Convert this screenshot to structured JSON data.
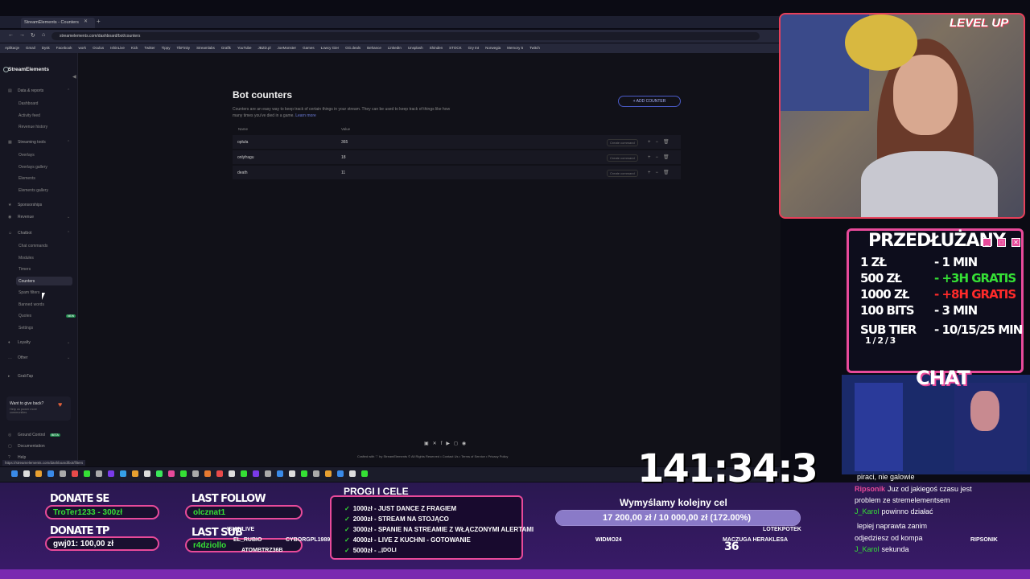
{
  "browser": {
    "tab_title": "StreamElements - Counters",
    "url": "streamelements.com/dashboard/bot/counters",
    "bookmarks": [
      "Aplikacje",
      "Gmail",
      "Dysk",
      "Facebook",
      "work",
      "Oculus",
      "IshinLive",
      "Kick",
      "Twitter",
      "Tippy",
      "TikFinity",
      "Streamlabs",
      "Grafik",
      "YouTube",
      "JBZD.pl",
      "JoeMonster",
      "Games",
      "Łowcy Gier",
      "GG.deals",
      "Behance",
      "LinkedIn",
      "Unsplash",
      "Shinden",
      "STOCK",
      "Gry tnt",
      "Norwegia",
      "Memory 5",
      "Twitch"
    ]
  },
  "sidebar": {
    "brand": "StreamElements",
    "sections": [
      {
        "label": "Data & reports",
        "items": [
          "Dashboard",
          "Activity feed",
          "Revenue history"
        ]
      },
      {
        "label": "Streaming tools",
        "items": [
          "Overlays",
          "Overlays gallery",
          "Elements",
          "Elements gallery"
        ]
      },
      {
        "label": "Sponsorships"
      },
      {
        "label": "Revenue"
      },
      {
        "label": "Chatbot",
        "items": [
          "Chat commands",
          "Modules",
          "Timers",
          "Counters",
          "Spam filters",
          "Banned words",
          "Quotes",
          "Settings"
        ]
      },
      {
        "label": "Loyalty"
      },
      {
        "label": "Other"
      },
      {
        "label": "GrabTap"
      }
    ],
    "new_badge": "NEW",
    "giveback_title": "Want to give back?",
    "giveback_text": "Help us power more communities",
    "bottom_links": [
      "Ground Control",
      "Documentation",
      "Help"
    ],
    "beta_badge": "BETA"
  },
  "main": {
    "title": "Bot counters",
    "description": "Counters are an easy way to keep track of certain things in your stream. They can be used to keep track of things like how many times you've died in a game.",
    "learn_more": "Learn more",
    "add_button": "+ ADD COUNTER",
    "columns": [
      "Name",
      "Value"
    ],
    "counters": [
      {
        "name": "opłuła",
        "value": "365"
      },
      {
        "name": "onlyfragu",
        "value": "18"
      },
      {
        "name": "death",
        "value": "11"
      }
    ],
    "create_command": "Create command",
    "footer": "Crafted with ♡ by StreamElements © All Rights Reserved • Contact Us • Terms of Service • Privacy Policy",
    "status_url": "https://streamelements.com/dashboard/bot/filters"
  },
  "overlay": {
    "logo": "LEVEL UP",
    "panel_title": "PRZEDŁUŻANY",
    "rates": [
      {
        "left": "1 ZŁ",
        "right": "- 1 MIN"
      },
      {
        "left": "500 ZŁ",
        "right": "- +3H GRATIS"
      },
      {
        "left": "1000 ZŁ",
        "right": "- +8H GRATIS"
      },
      {
        "left": "100 BITS",
        "right": "- 3 MIN"
      },
      {
        "left": "SUB TIER",
        "right": "- 10/15/25 MIN"
      }
    ],
    "sub_tiers": "1 / 2 / 3",
    "chat_title": "CHAT",
    "timer": "141:34:3",
    "donate_se_label": "DONATE SE",
    "donate_se_value": "TroTer1233 - 300zł",
    "donate_tp_label": "DONATE TP",
    "donate_tp_value": "gwj01: 100,00 zł",
    "last_follow_label": "LAST FOLLOW",
    "last_follow_value": "olcznat1",
    "last_sub_label": "LAST SUB",
    "last_sub_value": "r4dziollo",
    "goals_title": "PROGI I CELE",
    "goals": [
      "1000zł - JUST DANCE Z FRAGIEM",
      "2000zł - STREAM NA STOJĄCO",
      "3000zł - SPANIE NA STREAMIE Z WŁĄCZONYMI ALERTAMI",
      "4000zł - LIVE Z KUCHNI - GOTOWANIE",
      "5000zł - ..."
    ],
    "goal_name": "Wymyślamy kolejny cel",
    "goal_progress": "17 200,00 zł / 10 000,00 zł (172.00%)",
    "goal_percent": 1.0,
    "nicks": [
      "ISHINLIVE",
      "EL_RUBIO",
      "CYBORGPL1989",
      "ATOMBTRZ36B",
      "WIDMO24",
      "LOTEKPOTEK",
      "MACZUGA HERAKLESA",
      "RIPSONIK",
      "IDOLI"
    ],
    "chat": [
      {
        "user": "",
        "text": "piraci, nie galowie"
      },
      {
        "user": "Ripsonik",
        "text": "Juz od jakiegoś czasu jest"
      },
      {
        "user": "",
        "text": "problem ze stremelementsem"
      },
      {
        "user": "J_Karol",
        "text": "powinno działać"
      },
      {
        "user": "",
        "text": "lepiej naprawta zanim"
      },
      {
        "user": "",
        "text": "odjedziesz od kompa"
      },
      {
        "user": "J_Karol",
        "text": "sekunda"
      }
    ],
    "counter_display": "36"
  },
  "colors": {
    "accent": "#e84a9a",
    "brand": "#4a5bc8",
    "green": "#35e035",
    "red": "#ff2a2a"
  }
}
